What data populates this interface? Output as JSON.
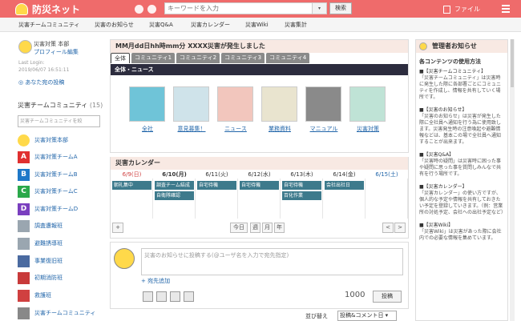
{
  "header": {
    "app_name": "防災ネット",
    "search_placeholder": "キーワードを入力",
    "search_button": "検索",
    "file_label": "ファイル"
  },
  "nav": [
    "災害チームコミュニティ",
    "災害のお知らせ",
    "災害Q&A",
    "災害カレンダー",
    "災害Wiki",
    "災害集計"
  ],
  "profile": {
    "name": "災害対策 本部",
    "edit_link": "プロフィール編集",
    "last_login_label": "Last Login:",
    "last_login_date": "2019/06/07 16:51:11",
    "posts_link": "◎ あなた宛の投稿"
  },
  "community": {
    "title": "災害チームコミュニティ",
    "count": "(15)",
    "search_placeholder": "災害チームコミュニティを絞",
    "items": [
      {
        "label": "災害対策本部",
        "badge": "",
        "color": "#ffd94a"
      },
      {
        "label": "災害対策チームA",
        "badge": "A",
        "color": "#e03030"
      },
      {
        "label": "災害対策チームB",
        "badge": "B",
        "color": "#1e78c8"
      },
      {
        "label": "災害対策チームC",
        "badge": "C",
        "color": "#2aa84a"
      },
      {
        "label": "災害対策チームD",
        "badge": "D",
        "color": "#7a3fbf"
      },
      {
        "label": "調査遭報班",
        "badge": "",
        "color": "#9aa6b0"
      },
      {
        "label": "避難誘導班",
        "badge": "",
        "color": "#9aa6b0"
      },
      {
        "label": "事業復旧班",
        "badge": "",
        "color": "#4a6aa0"
      },
      {
        "label": "初期消防班",
        "badge": "",
        "color": "#c83a3a"
      },
      {
        "label": "救護班",
        "badge": "",
        "color": "#d04040"
      },
      {
        "label": "災害チームコミュニティ",
        "badge": "",
        "color": "#888"
      }
    ]
  },
  "announcement": {
    "title": "MM月dd日hh時mm分 XXXX災害が発生しました",
    "tabs": [
      "全体",
      "コミュニティ1",
      "コミュニティ2",
      "コミュニティ3",
      "コミュニティ4"
    ],
    "news_bar": "全体・ニュース",
    "tiles": [
      {
        "label": "全社",
        "color": "#6fc4d8"
      },
      {
        "label": "意見募集！",
        "color": "#cfe3ea"
      },
      {
        "label": "ニュース",
        "color": "#f2c6bd"
      },
      {
        "label": "業務資料",
        "color": "#e9e4cf"
      },
      {
        "label": "マニュアル",
        "color": "#8a8a8a"
      },
      {
        "label": "災害対策",
        "color": "#bfe3d6"
      }
    ]
  },
  "calendar": {
    "title": "災害カレンダー",
    "days": [
      "6/9(日)",
      "6/10(月)",
      "6/11(火)",
      "6/12(水)",
      "6/13(木)",
      "6/14(金)",
      "6/15(土)"
    ],
    "events": [
      [
        "朝礼集中"
      ],
      [
        "調査チーム結成",
        "自衛隊確認"
      ],
      [
        "自宅待機"
      ],
      [
        "自宅待機"
      ],
      [
        "自宅待機",
        "百化作業"
      ],
      [
        "会社出社日"
      ],
      []
    ],
    "view_buttons": [
      "今日",
      "週",
      "月",
      "年"
    ],
    "add": "+",
    "prev": "<",
    "next": ">"
  },
  "post": {
    "placeholder": "災害のお知らせに投稿する(@ユーザ名を入力で宛先指定)",
    "add_recipient": "+ 宛先追加",
    "count": "1000",
    "submit": "投稿",
    "sort_label": "並び替え",
    "sort_value": "投稿&コメント日 ▾"
  },
  "admin": {
    "title": "管理者お知らせ",
    "subtitle": "各コンテンツの使用方法",
    "notes": [
      {
        "title": "■【災害チームコミュニティ】",
        "body": "「災害チームコミュニティ」は災害時に発生した際に各部署ごとにコミュニティを作成し、情報を共有していく場所です。"
      },
      {
        "title": "■【災害のお知らせ】",
        "body": "「災害のお知らせ」は災害が発生した際に全社員へ通知を行う為に使用致します。災害発生時の注意喚起や避難情報などは、基本この場で全社員へ通知することが出来ます。"
      },
      {
        "title": "■【災害Q&A】",
        "body": "「災害時の疑問」は災害時に困った事や疑問に思った事を質問しみんなで共有を行う場所です。"
      },
      {
        "title": "■【災害カレンダー】",
        "body": "「災害カレンダー」の使い方ですが、個人的な予定や情報を共有しておきたい予定を登録していきます。（例：営業所の対処予定、会社への出社予定など）"
      },
      {
        "title": "■【災害Wiki】",
        "body": "「災害Wiki」は災害があった際に会社内での必要な情報を集めています。"
      }
    ]
  }
}
